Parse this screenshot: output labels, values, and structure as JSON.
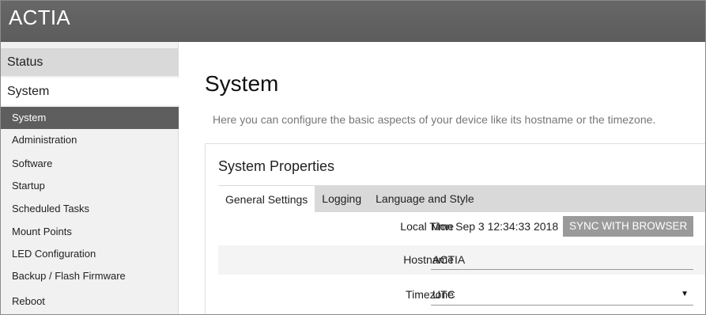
{
  "header": {
    "brand": "ACTIA"
  },
  "sidebar": {
    "sections": [
      {
        "label": "Status"
      },
      {
        "label": "System"
      }
    ],
    "items": [
      {
        "label": "System",
        "active": true
      },
      {
        "label": "Administration"
      },
      {
        "label": "Software"
      },
      {
        "label": "Startup"
      },
      {
        "label": "Scheduled Tasks"
      },
      {
        "label": "Mount Points"
      },
      {
        "label": "LED Configuration"
      },
      {
        "label": "Backup / Flash Firmware"
      },
      {
        "label": "Reboot"
      }
    ]
  },
  "main": {
    "title": "System",
    "description": "Here you can configure the basic aspects of your device like its hostname or the timezone.",
    "panel": {
      "title": "System Properties",
      "tabs": [
        {
          "label": "General Settings",
          "active": true
        },
        {
          "label": "Logging"
        },
        {
          "label": "Language and Style"
        }
      ],
      "fields": {
        "local_time": {
          "label": "Local Time",
          "value": "Mon Sep 3 12:34:33 2018",
          "button": "SYNC WITH BROWSER"
        },
        "hostname": {
          "label": "Hostname",
          "value": "ACTIA"
        },
        "timezone": {
          "label": "Timezone",
          "value": "UTC",
          "icon": "dropdown-caret"
        }
      }
    }
  },
  "colors": {
    "header_bg": "#5f5f5f",
    "sidebar_bg": "#f1f1f1",
    "active_item_bg": "#5e5e5e",
    "button_bg": "#9a9a9a"
  }
}
